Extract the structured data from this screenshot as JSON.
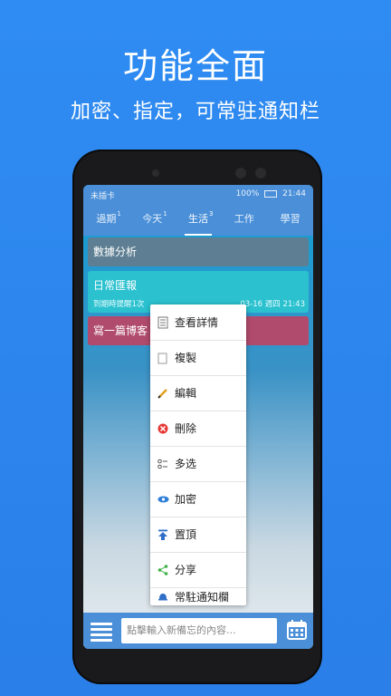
{
  "promo": {
    "headline": "功能全面",
    "subline": "加密、指定，可常驻通知栏"
  },
  "status_bar": {
    "left": "未插卡",
    "battery": "100%",
    "time": "21:44"
  },
  "tabs": [
    {
      "label": "過期",
      "count": "1",
      "active": false
    },
    {
      "label": "今天",
      "count": "1",
      "active": false
    },
    {
      "label": "生活",
      "count": "3",
      "active": true
    },
    {
      "label": "工作",
      "count": "",
      "active": false
    },
    {
      "label": "學習",
      "count": "",
      "active": false
    }
  ],
  "notes": [
    {
      "title": "數據分析",
      "color": "#5e7f93"
    },
    {
      "title": "日常匯報",
      "reminder": "到期時提醒1次",
      "datetime": "03-16 週四 21:43",
      "color": "#2bc1cf"
    },
    {
      "title": "寫一篇博客",
      "color": "#b04b6d"
    }
  ],
  "context_menu": [
    {
      "label": "查看詳情",
      "icon": "document-icon"
    },
    {
      "label": "複製",
      "icon": "copy-icon"
    },
    {
      "label": "編輯",
      "icon": "pencil-icon"
    },
    {
      "label": "刪除",
      "icon": "delete-icon"
    },
    {
      "label": "多选",
      "icon": "multi-select-icon"
    },
    {
      "label": "加密",
      "icon": "eye-icon"
    },
    {
      "label": "置頂",
      "icon": "pin-top-icon"
    },
    {
      "label": "分享",
      "icon": "share-icon"
    },
    {
      "label": "常駐通知欄",
      "icon": "bell-icon"
    }
  ],
  "bottom_bar": {
    "input_placeholder": "點擊輸入新備忘的內容..."
  },
  "colors": {
    "background": "#2f8cf2",
    "app_bar": "#4a8fd8",
    "accent": "#ffffff"
  }
}
